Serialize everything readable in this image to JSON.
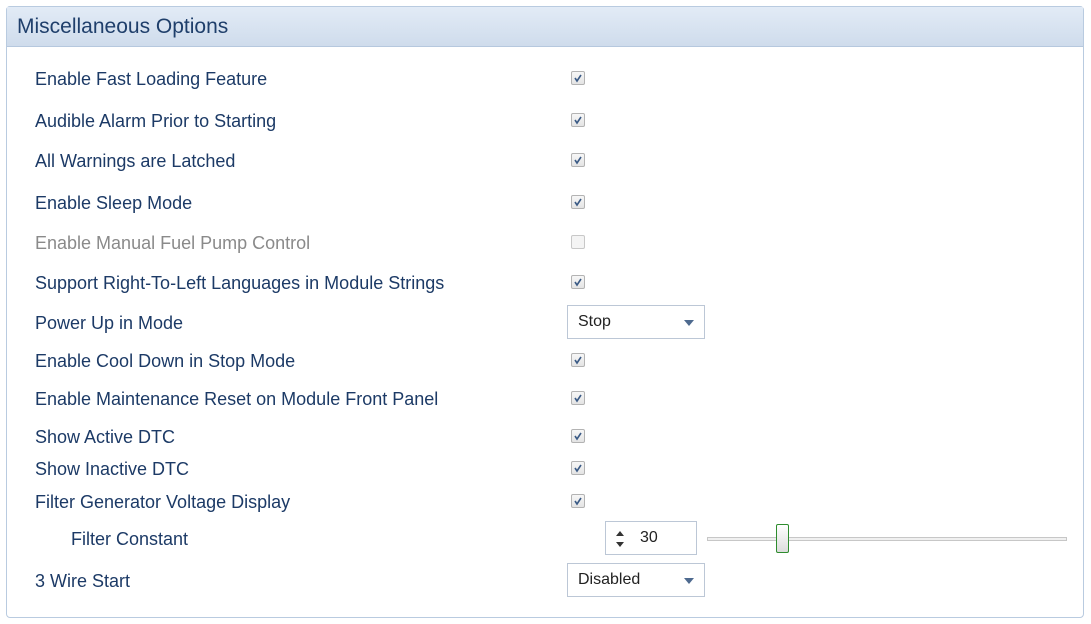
{
  "panel": {
    "title": "Miscellaneous Options"
  },
  "options": {
    "fast_loading": {
      "label": "Enable Fast Loading Feature",
      "checked": true
    },
    "audible_alarm": {
      "label": "Audible Alarm Prior to Starting",
      "checked": true
    },
    "warnings_latched": {
      "label": "All Warnings are Latched",
      "checked": true
    },
    "sleep_mode": {
      "label": "Enable Sleep Mode",
      "checked": true
    },
    "manual_fuel_pump": {
      "label": "Enable Manual Fuel Pump Control",
      "checked": false,
      "disabled": true
    },
    "rtl_languages": {
      "label": "Support Right-To-Left Languages in Module Strings",
      "checked": true
    },
    "power_up_mode": {
      "label": "Power Up in Mode",
      "value": "Stop"
    },
    "cool_down_stop": {
      "label": "Enable Cool Down in Stop Mode",
      "checked": true
    },
    "maintenance_reset": {
      "label": "Enable Maintenance Reset on Module Front Panel",
      "checked": true
    },
    "show_active_dtc": {
      "label": "Show Active DTC",
      "checked": true
    },
    "show_inactive_dtc": {
      "label": "Show Inactive DTC",
      "checked": true
    },
    "filter_gen_voltage": {
      "label": "Filter Generator Voltage Display",
      "checked": true
    },
    "filter_constant": {
      "label": "Filter Constant",
      "value": "30",
      "slider_fraction": 0.2
    },
    "three_wire_start": {
      "label": "3 Wire Start",
      "value": "Disabled"
    }
  },
  "colors": {
    "label": "#1c3a66",
    "disabled_label": "#8a8a8a",
    "header_bg": "#d9e4f1",
    "slider_thumb_border": "#2e8c2e"
  },
  "icons": {
    "checkbox_mark": "check-icon",
    "dropdown": "chevron-down-icon",
    "spinner": "spin-arrows-icon"
  }
}
